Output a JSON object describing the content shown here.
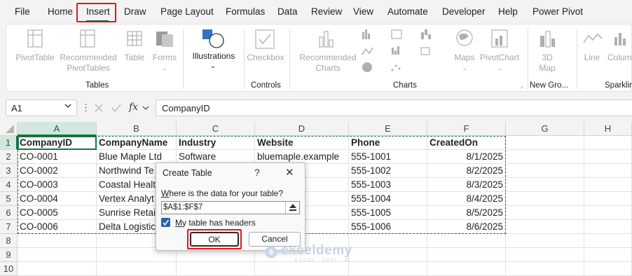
{
  "tabs": [
    "File",
    "Home",
    "Insert",
    "Draw",
    "Page Layout",
    "Formulas",
    "Data",
    "Review",
    "View",
    "Automate",
    "Developer",
    "Help",
    "Power Pivot"
  ],
  "ribbon": {
    "tables_group": {
      "label": "Tables",
      "items": [
        "PivotTable",
        "Recommended PivotTables",
        "Table",
        "Forms"
      ]
    },
    "illustrations": {
      "label": "Illustrations"
    },
    "controls_group": {
      "label": "Controls",
      "items": [
        "Checkbox"
      ]
    },
    "charts_group": {
      "label": "Charts",
      "items": [
        "Recommended Charts",
        "Maps",
        "PivotChart"
      ]
    },
    "newgroup": {
      "label": "New Gro...",
      "items": [
        "3D Map"
      ]
    },
    "sparklines": {
      "label": "Sparklin",
      "items": [
        "Line",
        "Colum"
      ]
    }
  },
  "formula_bar": {
    "name_box": "A1",
    "fx": "fx",
    "content": "CompanyID"
  },
  "columns": [
    "A",
    "B",
    "C",
    "D",
    "E",
    "F",
    "G",
    "H"
  ],
  "rows": [
    "1",
    "2",
    "3",
    "4",
    "5",
    "6",
    "7",
    "8",
    "9",
    "10"
  ],
  "table": {
    "headers": [
      "CompanyID",
      "CompanyName",
      "Industry",
      "Website",
      "Phone",
      "CreatedOn"
    ],
    "data": [
      [
        "CO-0001",
        "Blue Maple Ltd",
        "Software",
        "bluemaple.example",
        "555-1001",
        "8/1/2025"
      ],
      [
        "CO-0002",
        "Northwind Te",
        "",
        "...example",
        "555-1002",
        "8/2/2025"
      ],
      [
        "CO-0003",
        "Coastal Healt",
        "",
        "...mple",
        "555-1003",
        "8/3/2025"
      ],
      [
        "CO-0004",
        "Vertex Analyt",
        "",
        "...mple",
        "555-1004",
        "8/4/2025"
      ],
      [
        "CO-0005",
        "Sunrise Retail",
        "",
        "...mple",
        "555-1005",
        "8/5/2025"
      ],
      [
        "CO-0006",
        "Delta Logistic",
        "",
        "...ple",
        "555-1006",
        "8/6/2025"
      ]
    ]
  },
  "dialog": {
    "title": "Create Table",
    "help": "?",
    "close": "✕",
    "prompt": "Where is the data for your table?",
    "range": "$A$1:$F$7",
    "checkbox_label": "My table has headers",
    "ok": "OK",
    "cancel": "Cancel"
  },
  "watermark": {
    "name": "exceldemy",
    "tagline": "EXCEL · DATA · BI"
  },
  "colors": {
    "accent": "#1b7343",
    "highlight": "#e0151b",
    "checkbox": "#2464b4"
  }
}
